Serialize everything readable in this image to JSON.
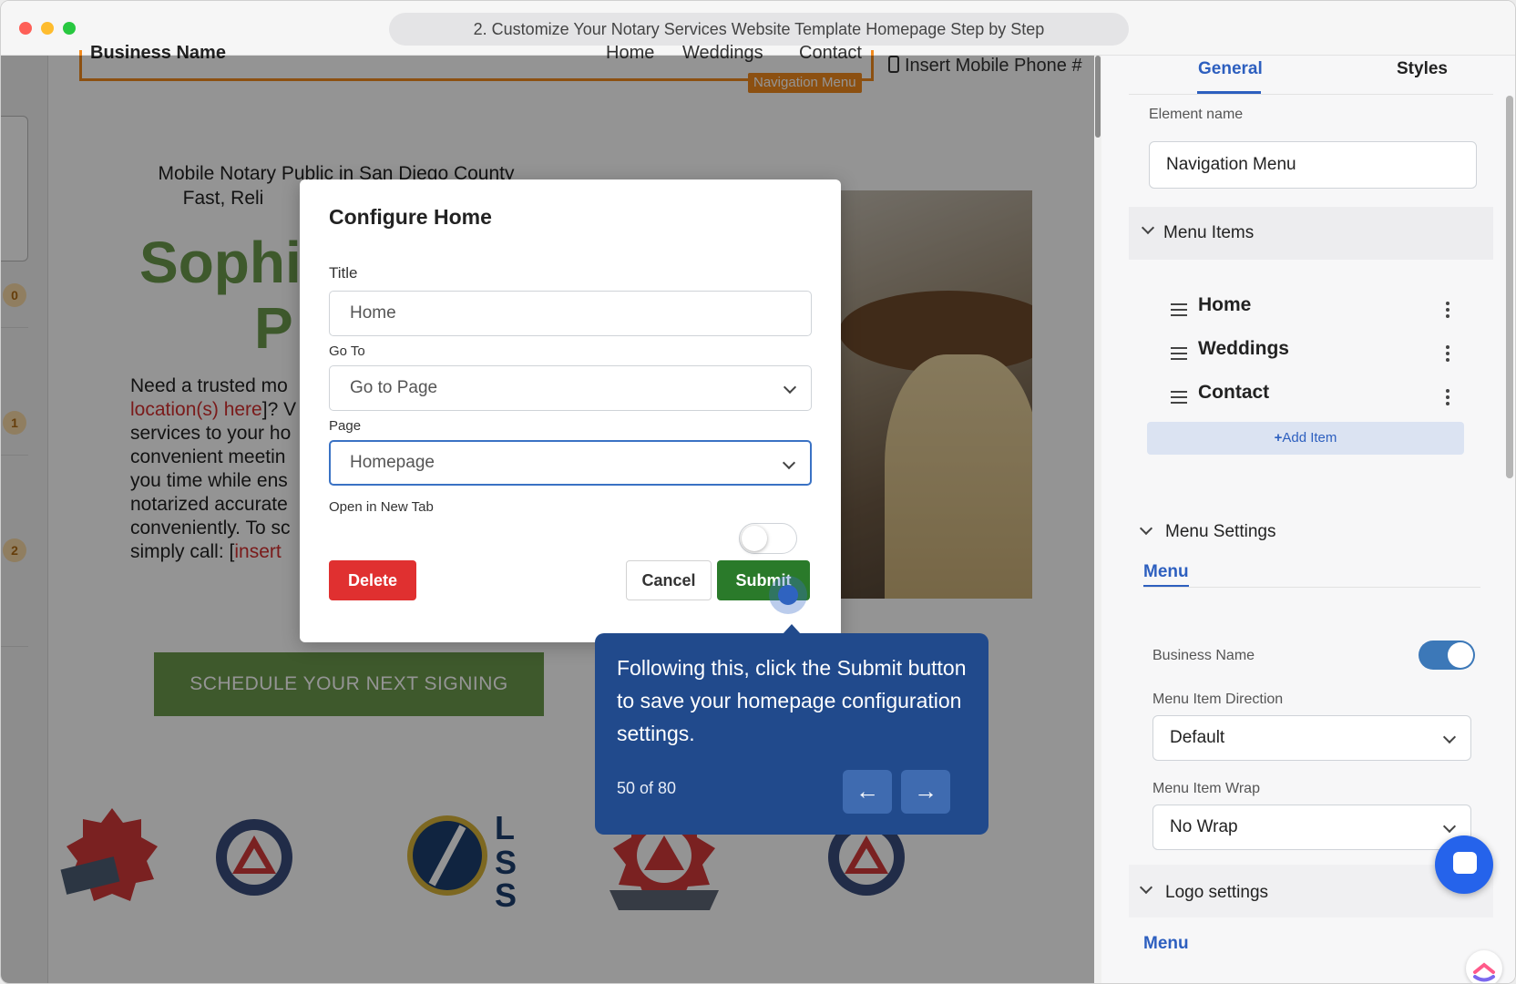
{
  "window": {
    "title": "2. Customize Your Notary Services Website Template Homepage Step by Step"
  },
  "site": {
    "business_name": "Business Name",
    "nav_links": [
      "Home",
      "Weddings",
      "Contact"
    ],
    "nav_badge": "Navigation Menu",
    "phone": "Insert Mobile Phone #",
    "kicker_line1": "Mobile Notary Public in San Diego County",
    "kicker_line2": "Fast, Reli",
    "name_line1": "Sophi",
    "name_line2": "P",
    "body_line1": "Need a trusted mo",
    "body_line2_red": "location(s) here",
    "body_line2_rest": "]? V",
    "body_line3": "services to your ho",
    "body_line4": "convenient meetin",
    "body_line5": "you time while ens",
    "body_line6": "notarized accurate",
    "body_line7": "conveniently. To sc",
    "body_line8_pre": "simply call: [",
    "body_line8_red": "insert",
    "cta": "SCHEDULE YOUR NEXT SIGNING",
    "step_numbers": [
      "0",
      "1",
      "2"
    ]
  },
  "modal": {
    "title": "Configure Home",
    "title_label": "Title",
    "title_value": "Home",
    "goto_label": "Go To",
    "goto_value": "Go to Page",
    "page_label": "Page",
    "page_value": "Homepage",
    "newtab_label": "Open in New Tab",
    "newtab_on": false,
    "delete_label": "Delete",
    "cancel_label": "Cancel",
    "submit_label": "Submit"
  },
  "tooltip": {
    "text": "Following this, click the Submit button to save your homepage configuration settings.",
    "count": "50 of 80",
    "prev_icon": "arrow-left-icon",
    "next_icon": "arrow-right-icon"
  },
  "panel": {
    "tabs": [
      "General",
      "Styles"
    ],
    "active_tab": "General",
    "element_name_label": "Element name",
    "element_name_value": "Navigation Menu",
    "menu_items_label": "Menu Items",
    "menu_items": [
      "Home",
      "Weddings",
      "Contact"
    ],
    "add_item_label": "Add Item",
    "menu_settings_label": "Menu Settings",
    "sub_tab": "Menu",
    "business_name_label": "Business Name",
    "business_name_on": true,
    "direction_label": "Menu Item Direction",
    "direction_value": "Default",
    "wrap_label": "Menu Item Wrap",
    "wrap_value": "No Wrap",
    "logo_settings_label": "Logo settings",
    "logo_sub_tab": "Menu"
  },
  "colors": {
    "accent": "#2d5fbf",
    "tooltip_bg": "#214a8c",
    "submit": "#2a7a2a",
    "delete": "#e03030",
    "brand_green": "#6b9a4c",
    "nav_outline": "#f28a1e"
  }
}
